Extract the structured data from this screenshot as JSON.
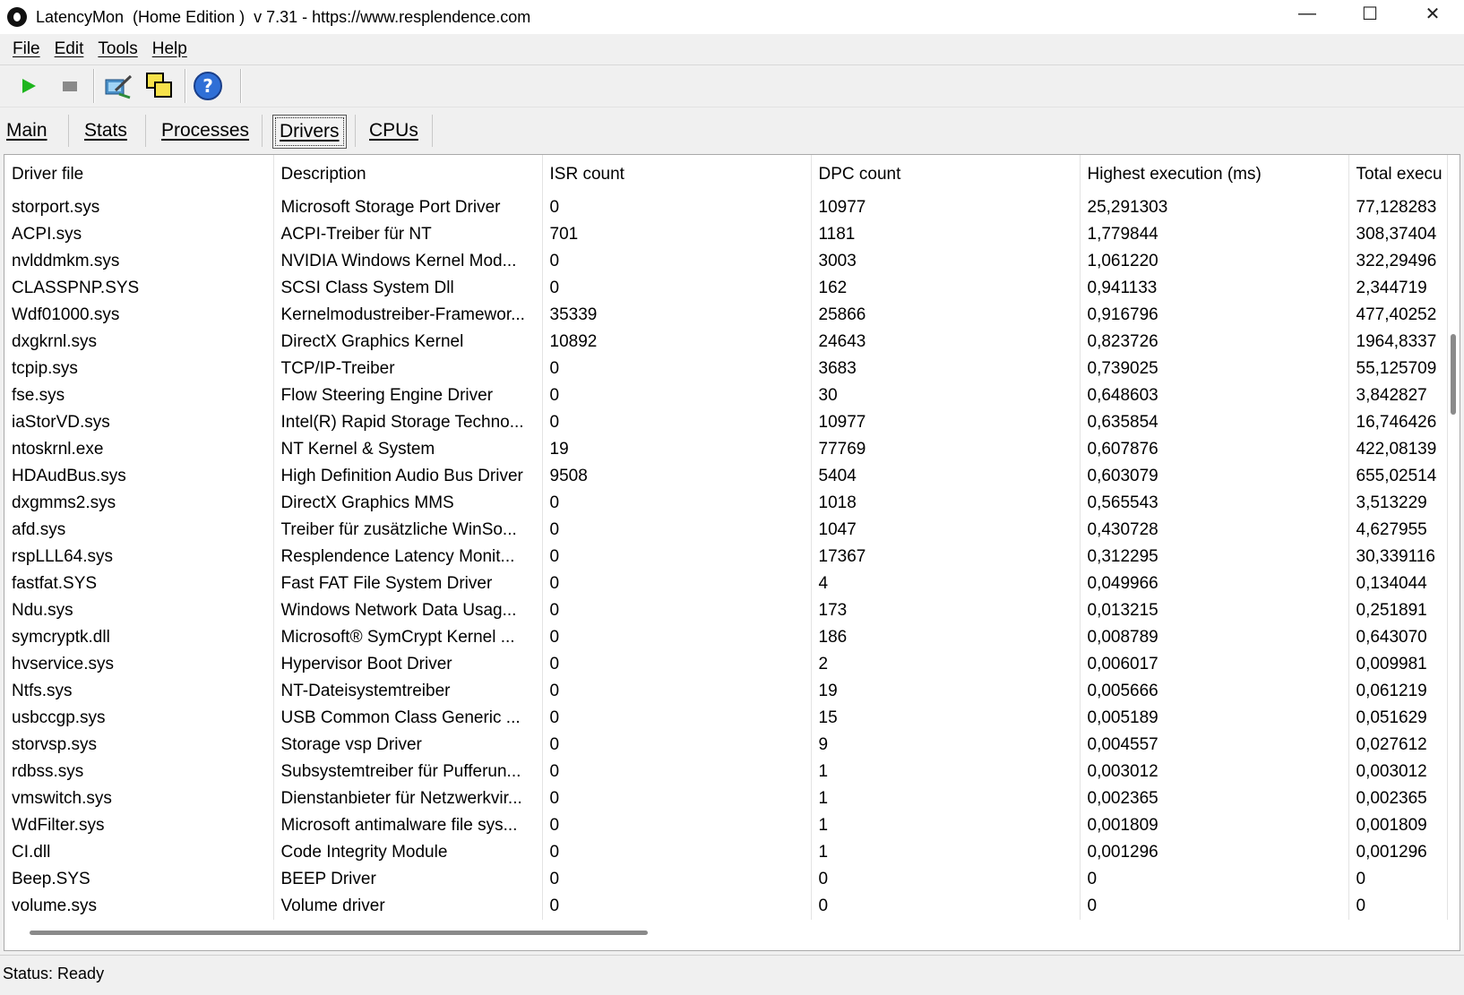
{
  "window": {
    "title": "LatencyMon  (Home Edition )  v 7.31 - https://www.resplendence.com",
    "minimize": "—",
    "maximize": "☐",
    "close": "✕"
  },
  "menu": [
    "File",
    "Edit",
    "Tools",
    "Help"
  ],
  "toolbar": {
    "play": "play-icon",
    "stop": "stop-icon",
    "tools": "tools-icon",
    "windows": "windows-icon",
    "help": "help-icon"
  },
  "tabs": [
    "Main",
    "Stats",
    "Processes",
    "Drivers",
    "CPUs"
  ],
  "active_tab": "Drivers",
  "table": {
    "columns": [
      "Driver file",
      "Description",
      "ISR count",
      "DPC count",
      "Highest execution (ms)",
      "Total execu"
    ],
    "rows": [
      [
        "storport.sys",
        "Microsoft Storage Port Driver",
        "0",
        "10977",
        "25,291303",
        "77,128283"
      ],
      [
        "ACPI.sys",
        "ACPI-Treiber für NT",
        "701",
        "1181",
        "1,779844",
        "308,37404"
      ],
      [
        "nvlddmkm.sys",
        "NVIDIA Windows Kernel Mod...",
        "0",
        "3003",
        "1,061220",
        "322,29496"
      ],
      [
        "CLASSPNP.SYS",
        "SCSI Class System Dll",
        "0",
        "162",
        "0,941133",
        "2,344719"
      ],
      [
        "Wdf01000.sys",
        "Kernelmodustreiber-Framewor...",
        "35339",
        "25866",
        "0,916796",
        "477,40252"
      ],
      [
        "dxgkrnl.sys",
        "DirectX Graphics Kernel",
        "10892",
        "24643",
        "0,823726",
        "1964,8337"
      ],
      [
        "tcpip.sys",
        "TCP/IP-Treiber",
        "0",
        "3683",
        "0,739025",
        "55,125709"
      ],
      [
        "fse.sys",
        "Flow Steering Engine Driver",
        "0",
        "30",
        "0,648603",
        "3,842827"
      ],
      [
        "iaStorVD.sys",
        "Intel(R) Rapid Storage Techno...",
        "0",
        "10977",
        "0,635854",
        "16,746426"
      ],
      [
        "ntoskrnl.exe",
        "NT Kernel & System",
        "19",
        "77769",
        "0,607876",
        "422,08139"
      ],
      [
        "HDAudBus.sys",
        "High Definition Audio Bus Driver",
        "9508",
        "5404",
        "0,603079",
        "655,02514"
      ],
      [
        "dxgmms2.sys",
        "DirectX Graphics MMS",
        "0",
        "1018",
        "0,565543",
        "3,513229"
      ],
      [
        "afd.sys",
        "Treiber für zusätzliche WinSo...",
        "0",
        "1047",
        "0,430728",
        "4,627955"
      ],
      [
        "rspLLL64.sys",
        "Resplendence Latency Monit...",
        "0",
        "17367",
        "0,312295",
        "30,339116"
      ],
      [
        "fastfat.SYS",
        "Fast FAT File System Driver",
        "0",
        "4",
        "0,049966",
        "0,134044"
      ],
      [
        "Ndu.sys",
        "Windows Network Data Usag...",
        "0",
        "173",
        "0,013215",
        "0,251891"
      ],
      [
        "symcryptk.dll",
        "Microsoft® SymCrypt Kernel ...",
        "0",
        "186",
        "0,008789",
        "0,643070"
      ],
      [
        "hvservice.sys",
        "Hypervisor Boot Driver",
        "0",
        "2",
        "0,006017",
        "0,009981"
      ],
      [
        "Ntfs.sys",
        "NT-Dateisystemtreiber",
        "0",
        "19",
        "0,005666",
        "0,061219"
      ],
      [
        "usbccgp.sys",
        "USB Common Class Generic ...",
        "0",
        "15",
        "0,005189",
        "0,051629"
      ],
      [
        "storvsp.sys",
        "Storage vsp Driver",
        "0",
        "9",
        "0,004557",
        "0,027612"
      ],
      [
        "rdbss.sys",
        "Subsystemtreiber für Pufferun...",
        "0",
        "1",
        "0,003012",
        "0,003012"
      ],
      [
        "vmswitch.sys",
        "Dienstanbieter für Netzwerkvir...",
        "0",
        "1",
        "0,002365",
        "0,002365"
      ],
      [
        "WdFilter.sys",
        "Microsoft antimalware file sys...",
        "0",
        "1",
        "0,001809",
        "0,001809"
      ],
      [
        "CI.dll",
        "Code Integrity Module",
        "0",
        "1",
        "0,001296",
        "0,001296"
      ],
      [
        "Beep.SYS",
        "BEEP Driver",
        "0",
        "0",
        "0",
        "0"
      ],
      [
        "volume.sys",
        "Volume driver",
        "0",
        "0",
        "0",
        "0"
      ]
    ]
  },
  "status": "Status: Ready"
}
